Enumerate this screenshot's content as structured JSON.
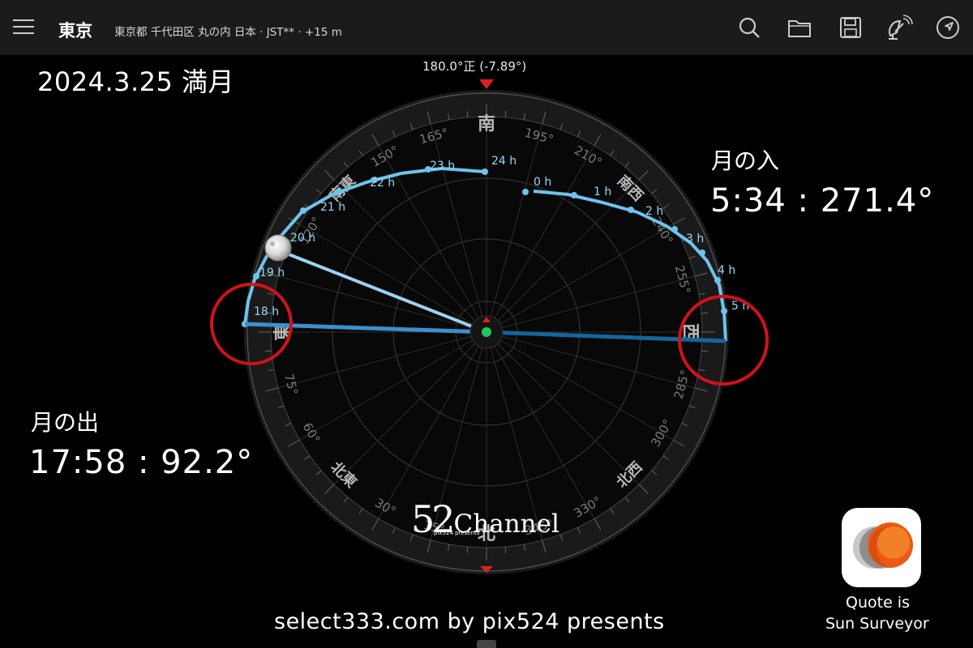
{
  "toolbar": {
    "title": "東京",
    "subtitle": "東京都 千代田区 丸の内 日本 · JST** · +15 m",
    "icons": [
      "menu-icon",
      "search-icon",
      "folder-icon",
      "save-icon",
      "satellite-icon",
      "navigation-icon"
    ]
  },
  "overlay": {
    "date_label": "2024.3.25 満月",
    "moonrise_title": "月の出",
    "moonrise_value": "17:58 : 92.2°",
    "moonset_title": "月の入",
    "moonset_value": "5:34 : 271.4°",
    "footer": "select333.com by pix524 presents",
    "quote_line1": "Quote is",
    "quote_line2": "Sun Surveyor"
  },
  "logo": {
    "number": "52",
    "word": "Channel",
    "sub": "pix524 presents"
  },
  "compass": {
    "heading_label": "180.0°正 (-7.89°)",
    "cardinal_labels": {
      "south": "南",
      "east": "東",
      "west": "西",
      "north": "北"
    },
    "intercardinal_labels": {
      "southeast": "南東",
      "southwest": "南西",
      "northeast": "北東",
      "northwest": "北西"
    },
    "degree_labels": [
      "165°",
      "195°",
      "150°",
      "210°",
      "120°",
      "240°",
      "255°",
      "75°",
      "285°",
      "60°",
      "300°",
      "30°",
      "330°",
      "15°",
      "345°"
    ],
    "moon_hour_labels": [
      "18 h",
      "19 h",
      "20 h",
      "21 h",
      "22 h",
      "23 h",
      "24 h",
      "0 h",
      "1 h",
      "2 h",
      "3 h",
      "4 h",
      "5 h"
    ],
    "moonrise_azimuth": 92.2,
    "moonset_azimuth": 271.4,
    "current_moon_azimuth": 113
  },
  "colors": {
    "path": "#6ec3ec",
    "rise_line": "#3a8fd0",
    "set_line": "#15659e",
    "highlight_circle": "#d0121a",
    "marker": "#e02020",
    "center": "#22c55e"
  }
}
